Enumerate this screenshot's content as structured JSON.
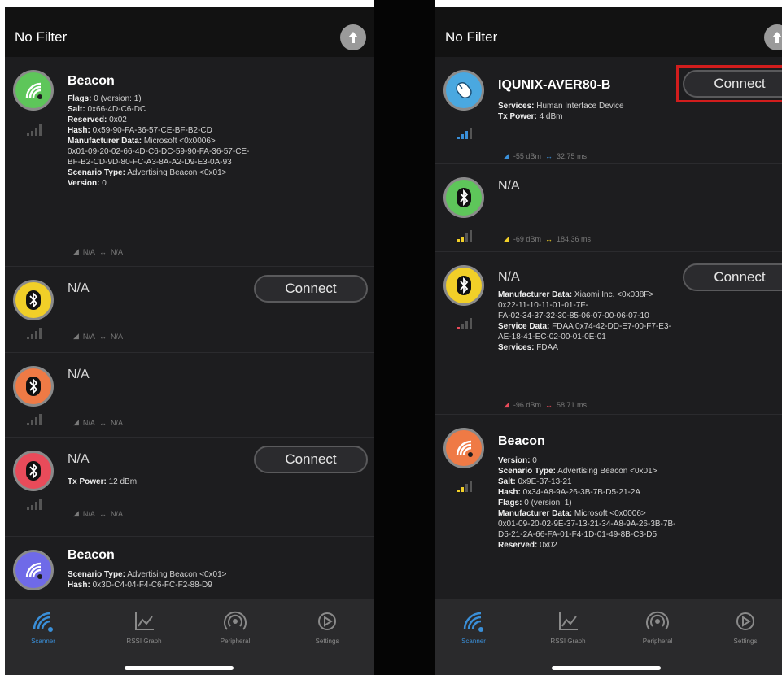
{
  "left": {
    "nav_title": "No Filter",
    "devices": [
      {
        "name": "Beacon",
        "icon": "wifi-beacon-icon",
        "color": "#5ec65a",
        "lines": [
          {
            "label": "Flags:",
            "value": "0 (version: 1)"
          },
          {
            "label": "Salt:",
            "value": "0x66-4D-C6-DC"
          },
          {
            "label": "Reserved:",
            "value": "0x02"
          },
          {
            "label": "Hash:",
            "value": "0x59-90-FA-36-57-CE-BF-B2-CD"
          },
          {
            "label": "Manufacturer Data:",
            "value": "Microsoft <0x0006>"
          },
          {
            "label": "",
            "value": "0x01-09-20-02-66-4D-C6-DC-59-90-FA-36-57-CE-"
          },
          {
            "label": "",
            "value": "BF-B2-CD-9D-80-FC-A3-8A-A2-D9-E3-0A-93"
          },
          {
            "label": "Scenario Type:",
            "value": "Advertising Beacon <0x01>"
          },
          {
            "label": "Version:",
            "value": "0"
          }
        ],
        "rssi": "N/A",
        "interval": "N/A"
      },
      {
        "name": "N/A",
        "icon": "bluetooth-icon",
        "color": "#f1cf28",
        "rssi": "N/A",
        "interval": "N/A",
        "connect": "Connect"
      },
      {
        "name": "N/A",
        "icon": "bluetooth-icon",
        "color": "#ef7a45",
        "rssi": "N/A",
        "interval": "N/A"
      },
      {
        "name": "N/A",
        "icon": "bluetooth-icon",
        "color": "#e94b5a",
        "lines": [
          {
            "label": "Tx Power:",
            "value": "12 dBm"
          }
        ],
        "rssi": "N/A",
        "interval": "N/A",
        "connect": "Connect"
      },
      {
        "name": "Beacon",
        "icon": "wifi-beacon-icon",
        "color": "#6f6ae8",
        "lines": [
          {
            "label": "Scenario Type:",
            "value": "Advertising Beacon <0x01>"
          },
          {
            "label": "Hash:",
            "value": "0x3D-C4-04-F4-C6-FC-F2-88-D9"
          }
        ]
      }
    ],
    "tabs": [
      {
        "label": "Scanner",
        "icon": "scanner-icon"
      },
      {
        "label": "RSSI Graph",
        "icon": "graph-icon"
      },
      {
        "label": "Peripheral",
        "icon": "broadcast-icon"
      },
      {
        "label": "Settings",
        "icon": "settings-icon"
      }
    ]
  },
  "right": {
    "nav_title": "No Filter",
    "devices": [
      {
        "name": "IQUNIX-AVER80-B",
        "icon": "mouse-icon",
        "color": "#4aa8e0",
        "lines": [
          {
            "label": "Services:",
            "value": "Human Interface Device"
          },
          {
            "label": "Tx Power:",
            "value": "4 dBm"
          }
        ],
        "rssi": "-55 dBm",
        "interval": "32.75 ms",
        "connect": "Connect",
        "rssi_color": "#3a8fd8"
      },
      {
        "name": "N/A",
        "icon": "bluetooth-icon",
        "color": "#5ec65a",
        "rssi": "-69 dBm",
        "interval": "184.36 ms",
        "rssi_color": "#f1cf28"
      },
      {
        "name": "N/A",
        "icon": "bluetooth-icon",
        "color": "#f1cf28",
        "lines": [
          {
            "label": "Manufacturer Data:",
            "value": "Xiaomi Inc. <0x038F>"
          },
          {
            "label": "",
            "value": "0x22-11-10-11-01-01-7F-"
          },
          {
            "label": "",
            "value": "FA-02-34-37-32-30-85-06-07-00-06-07-10"
          },
          {
            "label": "Service Data:",
            "value": "FDAA 0x74-42-DD-E7-00-F7-E3-"
          },
          {
            "label": "",
            "value": "AE-18-41-EC-02-00-01-0E-01"
          },
          {
            "label": "Services:",
            "value": "FDAA"
          }
        ],
        "rssi": "-96 dBm",
        "interval": "58.71 ms",
        "connect": "Connect",
        "rssi_color": "#e94b5a"
      },
      {
        "name": "Beacon",
        "icon": "wifi-beacon-icon",
        "color": "#ef7a45",
        "lines": [
          {
            "label": "Version:",
            "value": "0"
          },
          {
            "label": "Scenario Type:",
            "value": "Advertising Beacon <0x01>"
          },
          {
            "label": "Salt:",
            "value": "0x9E-37-13-21"
          },
          {
            "label": "Hash:",
            "value": "0x34-A8-9A-26-3B-7B-D5-21-2A"
          },
          {
            "label": "Flags:",
            "value": "0 (version: 1)"
          },
          {
            "label": "Manufacturer Data:",
            "value": "Microsoft <0x0006>"
          },
          {
            "label": "",
            "value": "0x01-09-20-02-9E-37-13-21-34-A8-9A-26-3B-7B-"
          },
          {
            "label": "",
            "value": "D5-21-2A-66-FA-01-F4-1D-01-49-8B-C3-D5"
          },
          {
            "label": "Reserved:",
            "value": "0x02"
          }
        ]
      }
    ],
    "tabs": [
      {
        "label": "Scanner",
        "icon": "scanner-icon"
      },
      {
        "label": "RSSI Graph",
        "icon": "graph-icon"
      },
      {
        "label": "Peripheral",
        "icon": "broadcast-icon"
      },
      {
        "label": "Settings",
        "icon": "settings-icon"
      }
    ]
  },
  "colors": {
    "highlight": "#d21d1d",
    "tab_active": "#3a8fd8"
  }
}
